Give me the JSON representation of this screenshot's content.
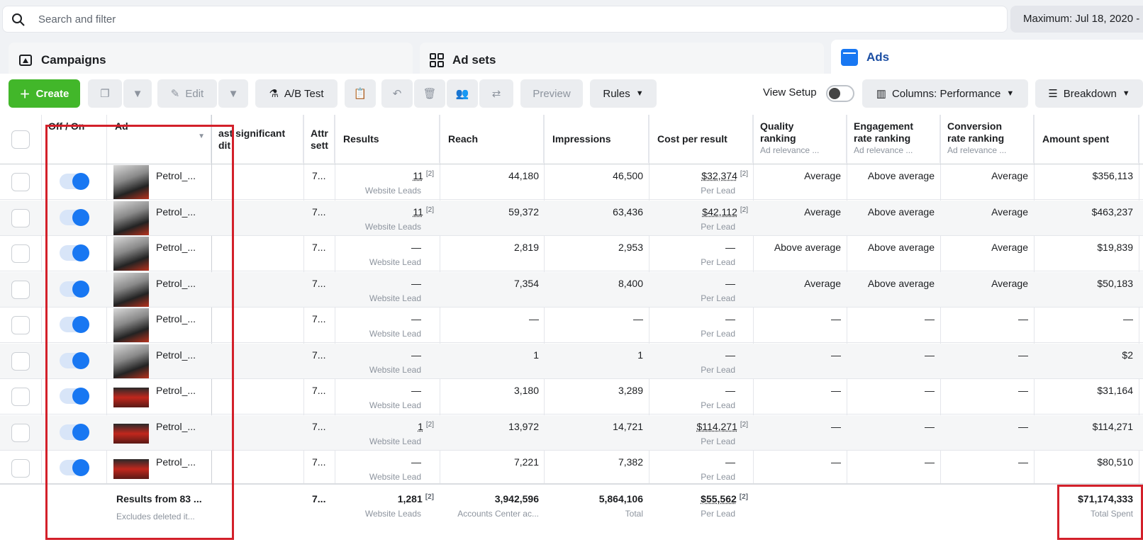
{
  "search": {
    "placeholder": "Search and filter"
  },
  "date_range": "Maximum: Jul 18, 2020 -",
  "tabs": {
    "campaigns": "Campaigns",
    "adsets": "Ad sets",
    "ads": "Ads"
  },
  "toolbar": {
    "create": "Create",
    "edit": "Edit",
    "ab_test": "A/B Test",
    "preview": "Preview",
    "rules": "Rules",
    "view_setup": "View Setup",
    "columns": "Columns: Performance",
    "breakdown": "Breakdown"
  },
  "columns": {
    "offon": "Off / On",
    "ad": "Ad",
    "last_edit": "ast significant",
    "last_edit2": "dit",
    "attr": "Attr",
    "attr2": "sett",
    "results": "Results",
    "reach": "Reach",
    "impressions": "Impressions",
    "cpr": "Cost per result",
    "quality": "Quality",
    "quality2": "ranking",
    "quality_sub": "Ad relevance ...",
    "engagement": "Engagement",
    "engagement2": "rate ranking",
    "engagement_sub": "Ad relevance ...",
    "conversion": "Conversion",
    "conversion2": "rate ranking",
    "conversion_sub": "Ad relevance ...",
    "spent": "Amount spent"
  },
  "rows": [
    {
      "ad": "Petrol_...",
      "attr": "7...",
      "results": "11",
      "results_fn": "[2]",
      "results_sub": "Website Leads",
      "reach": "44,180",
      "impressions": "46,500",
      "cpr": "$32,374",
      "cpr_fn": "[2]",
      "cpr_sub": "Per Lead",
      "quality": "Average",
      "engagement": "Above average",
      "conversion": "Average",
      "spent": "$356,113",
      "thumb": "person"
    },
    {
      "ad": "Petrol_...",
      "attr": "7...",
      "results": "11",
      "results_fn": "[2]",
      "results_sub": "Website Leads",
      "reach": "59,372",
      "impressions": "63,436",
      "cpr": "$42,112",
      "cpr_fn": "[2]",
      "cpr_sub": "Per Lead",
      "quality": "Average",
      "engagement": "Above average",
      "conversion": "Average",
      "spent": "$463,237",
      "thumb": "person"
    },
    {
      "ad": "Petrol_...",
      "attr": "7...",
      "results": "—",
      "results_fn": "",
      "results_sub": "Website Lead",
      "reach": "2,819",
      "impressions": "2,953",
      "cpr": "—",
      "cpr_fn": "",
      "cpr_sub": "Per Lead",
      "quality": "Above average",
      "engagement": "Above average",
      "conversion": "Average",
      "spent": "$19,839",
      "thumb": "person"
    },
    {
      "ad": "Petrol_...",
      "attr": "7...",
      "results": "—",
      "results_fn": "",
      "results_sub": "Website Lead",
      "reach": "7,354",
      "impressions": "8,400",
      "cpr": "—",
      "cpr_fn": "",
      "cpr_sub": "Per Lead",
      "quality": "Average",
      "engagement": "Above average",
      "conversion": "Average",
      "spent": "$50,183",
      "thumb": "person"
    },
    {
      "ad": "Petrol_...",
      "attr": "7...",
      "results": "—",
      "results_fn": "",
      "results_sub": "Website Lead",
      "reach": "—",
      "impressions": "—",
      "cpr": "—",
      "cpr_fn": "",
      "cpr_sub": "Per Lead",
      "quality": "—",
      "engagement": "—",
      "conversion": "—",
      "spent": "—",
      "thumb": "person"
    },
    {
      "ad": "Petrol_...",
      "attr": "7...",
      "results": "—",
      "results_fn": "",
      "results_sub": "Website Lead",
      "reach": "1",
      "impressions": "1",
      "cpr": "—",
      "cpr_fn": "",
      "cpr_sub": "Per Lead",
      "quality": "—",
      "engagement": "—",
      "conversion": "—",
      "spent": "$2",
      "thumb": "person"
    },
    {
      "ad": "Petrol_...",
      "attr": "7...",
      "results": "—",
      "results_fn": "",
      "results_sub": "Website Lead",
      "reach": "3,180",
      "impressions": "3,289",
      "cpr": "—",
      "cpr_fn": "",
      "cpr_sub": "Per Lead",
      "quality": "—",
      "engagement": "—",
      "conversion": "—",
      "spent": "$31,164",
      "thumb": "studio"
    },
    {
      "ad": "Petrol_...",
      "attr": "7...",
      "results": "1",
      "results_fn": "[2]",
      "results_sub": "Website Lead",
      "reach": "13,972",
      "impressions": "14,721",
      "cpr": "$114,271",
      "cpr_fn": "[2]",
      "cpr_sub": "Per Lead",
      "quality": "—",
      "engagement": "—",
      "conversion": "—",
      "spent": "$114,271",
      "thumb": "studio"
    },
    {
      "ad": "Petrol_...",
      "attr": "7...",
      "results": "—",
      "results_fn": "",
      "results_sub": "Website Lead",
      "reach": "7,221",
      "impressions": "7,382",
      "cpr": "—",
      "cpr_fn": "",
      "cpr_sub": "Per Lead",
      "quality": "—",
      "engagement": "—",
      "conversion": "—",
      "spent": "$80,510",
      "thumb": "studio"
    }
  ],
  "footer": {
    "label": "Results from 83 ...",
    "label_sub": "Excludes deleted it...",
    "attr": "7...",
    "results": "1,281",
    "results_fn": "[2]",
    "results_sub": "Website Leads",
    "reach": "3,942,596",
    "reach_sub": "Accounts Center ac...",
    "impressions": "5,864,106",
    "impressions_sub": "Total",
    "cpr": "$55,562",
    "cpr_fn": "[2]",
    "cpr_sub": "Per Lead",
    "spent": "$71,174,333",
    "spent_sub": "Total Spent"
  }
}
